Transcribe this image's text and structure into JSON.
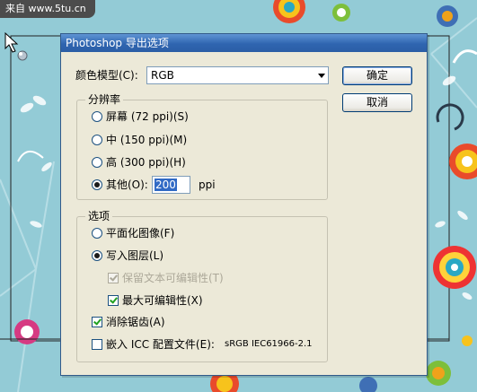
{
  "watermark": "来自 www.5tu.cn",
  "dialog": {
    "title": "Photoshop 导出选项",
    "color_model_label": "颜色模型(C):",
    "color_model_value": "RGB",
    "ok_button": "确定",
    "cancel_button": "取消",
    "resolution": {
      "legend": "分辨率",
      "options": [
        {
          "label": "屏幕 (72 ppi)(S)",
          "selected": false
        },
        {
          "label": "中 (150 ppi)(M)",
          "selected": false
        },
        {
          "label": "高 (300 ppi)(H)",
          "selected": false
        },
        {
          "label": "其他(O):",
          "selected": true
        }
      ],
      "other_value": "200",
      "unit": "ppi"
    },
    "options": {
      "legend": "选项",
      "flatten": {
        "label": "平面化图像(F)",
        "selected": false
      },
      "write_layers": {
        "label": "写入图层(L)",
        "selected": true
      },
      "preserve_text": {
        "label": "保留文本可编辑性(T)",
        "checked": true,
        "enabled": false
      },
      "max_edit": {
        "label": "最大可编辑性(X)",
        "checked": true,
        "enabled": true
      },
      "antialias": {
        "label": "消除锯齿(A)",
        "checked": true
      },
      "embed_icc": {
        "label": "嵌入 ICC 配置文件(E):",
        "checked": false
      },
      "icc_profile": "sRGB IEC61966-2.1"
    }
  },
  "colors": {
    "dialog_bg": "#ece9d8",
    "titlebar": "#2f65b0",
    "background": "#93cbd6"
  }
}
